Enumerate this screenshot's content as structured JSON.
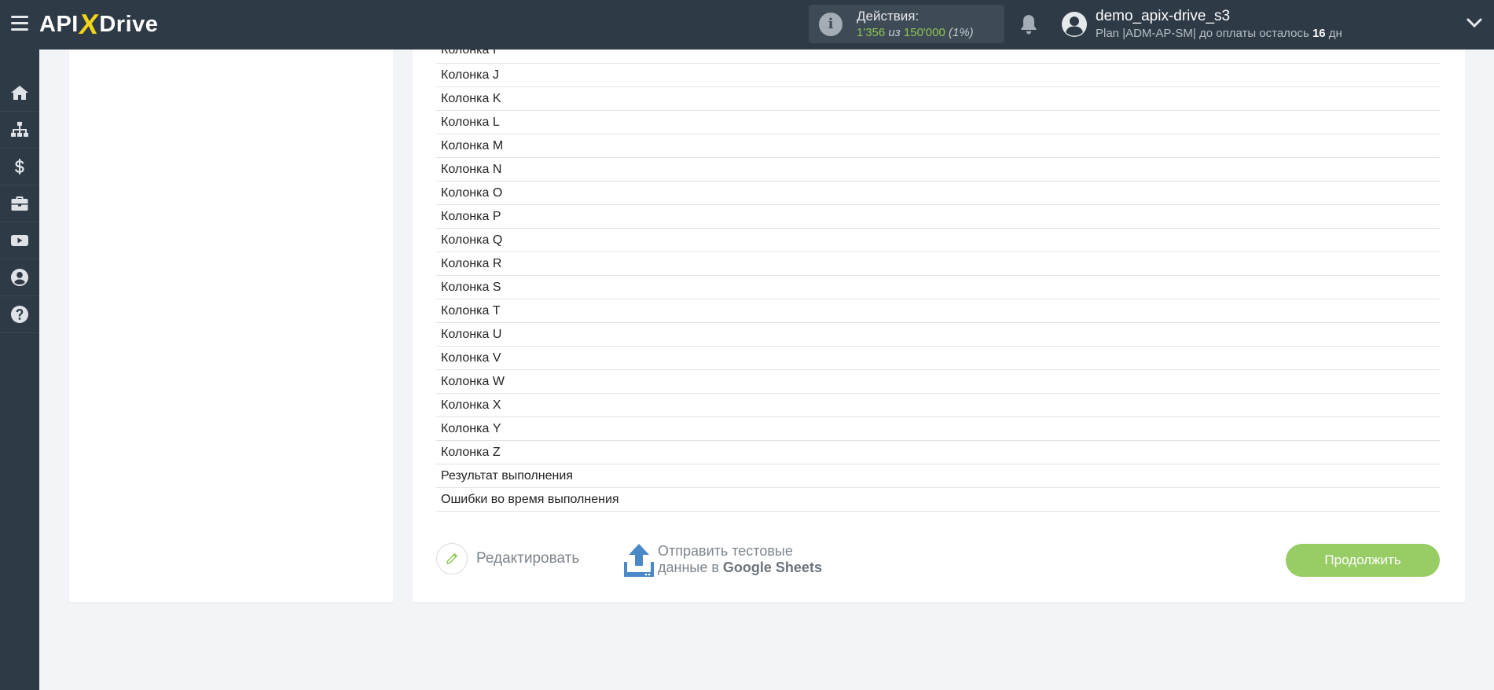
{
  "header": {
    "logo": {
      "left": "API",
      "x": "X",
      "right": "Drive"
    },
    "actions": {
      "title": "Действия:",
      "used": "1'356",
      "of": "из",
      "total": "150'000",
      "percent": "(1%)"
    },
    "user": {
      "name": "demo_apix-drive_s3",
      "plan_prefix": "Plan |ADM-AP-SM| до оплаты осталось",
      "days": "16",
      "days_unit": "дн"
    }
  },
  "sidebar": {
    "items": [
      {
        "icon": "home-icon"
      },
      {
        "icon": "sitemap-icon"
      },
      {
        "icon": "dollar-icon"
      },
      {
        "icon": "briefcase-icon"
      },
      {
        "icon": "youtube-icon"
      },
      {
        "icon": "user-circle-icon"
      },
      {
        "icon": "help-circle-icon"
      }
    ]
  },
  "fields": [
    "Колонка I",
    "Колонка J",
    "Колонка K",
    "Колонка L",
    "Колонка M",
    "Колонка N",
    "Колонка O",
    "Колонка P",
    "Колонка Q",
    "Колонка R",
    "Колонка S",
    "Колонка T",
    "Колонка U",
    "Колонка V",
    "Колонка W",
    "Колонка X",
    "Колонка Y",
    "Колонка Z",
    "Результат выполнения",
    "Ошибки во время выполнения"
  ],
  "footer": {
    "edit_label": "Редактировать",
    "send_line1": "Отправить тестовые",
    "send_line2_prefix": "данные в",
    "send_service": "Google Sheets",
    "continue_label": "Продолжить"
  },
  "colors": {
    "header_bg": "#2e3a46",
    "accent_green": "#98cc65",
    "logo_x": "#f4d31a"
  }
}
